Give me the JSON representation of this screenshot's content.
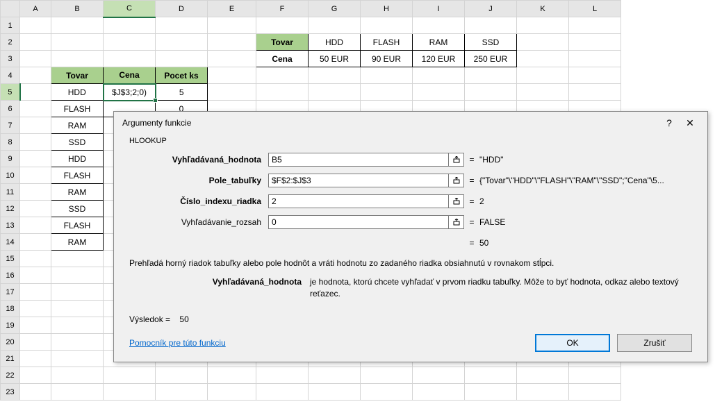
{
  "columns": [
    "A",
    "B",
    "C",
    "D",
    "E",
    "F",
    "G",
    "H",
    "I",
    "J",
    "K",
    "L"
  ],
  "row_count": 23,
  "active_col": "C",
  "active_row": 5,
  "cells": {
    "F2": {
      "text": "Tovar",
      "cls": "green-hdr"
    },
    "G2": {
      "text": "HDD",
      "cls": "bord"
    },
    "H2": {
      "text": "FLASH",
      "cls": "bord"
    },
    "I2": {
      "text": "RAM",
      "cls": "bord"
    },
    "J2": {
      "text": "SSD",
      "cls": "bord"
    },
    "F3": {
      "text": "Cena",
      "cls": "bord bold"
    },
    "G3": {
      "text": "50 EUR",
      "cls": "bord"
    },
    "H3": {
      "text": "90 EUR",
      "cls": "bord"
    },
    "I3": {
      "text": "120 EUR",
      "cls": "bord"
    },
    "J3": {
      "text": "250 EUR",
      "cls": "bord"
    },
    "B4": {
      "text": "Tovar",
      "cls": "green-hdr"
    },
    "C4": {
      "text": "Cena",
      "cls": "green-hdr"
    },
    "D4": {
      "text": "Pocet ks",
      "cls": "green-hdr"
    },
    "B5": {
      "text": "HDD",
      "cls": "bord"
    },
    "C5": {
      "text": "$J$3;2;0)",
      "cls": "bord"
    },
    "D5": {
      "text": "5",
      "cls": "bord"
    },
    "B6": {
      "text": "FLASH",
      "cls": "bord"
    },
    "C6": {
      "text": "",
      "cls": "bord"
    },
    "D6": {
      "text": "0",
      "cls": "bord"
    },
    "B7": {
      "text": "RAM",
      "cls": "bord"
    },
    "B8": {
      "text": "SSD",
      "cls": "bord"
    },
    "B9": {
      "text": "HDD",
      "cls": "bord"
    },
    "B10": {
      "text": "FLASH",
      "cls": "bord"
    },
    "B11": {
      "text": "RAM",
      "cls": "bord"
    },
    "B12": {
      "text": "SSD",
      "cls": "bord"
    },
    "B13": {
      "text": "FLASH",
      "cls": "bord"
    },
    "B14": {
      "text": "RAM",
      "cls": "bord"
    }
  },
  "dialog": {
    "title": "Argumenty funkcie",
    "help": "?",
    "close": "✕",
    "funcname": "HLOOKUP",
    "args": [
      {
        "label": "Vyhľadávaná_hodnota",
        "value": "B5",
        "evaluated": "\"HDD\"",
        "bold": true
      },
      {
        "label": "Pole_tabuľky",
        "value": "$F$2:$J$3",
        "evaluated": "{\"Tovar\"\\\"HDD\"\\\"FLASH\"\\\"RAM\"\\\"SSD\";\"Cena\"\\5...",
        "bold": true
      },
      {
        "label": "Číslo_indexu_riadka",
        "value": "2",
        "evaluated": "2",
        "bold": true
      },
      {
        "label": "Vyhľadávanie_rozsah",
        "value": "0",
        "evaluated": "FALSE",
        "bold": false
      }
    ],
    "result_eq": "=",
    "result_val": "50",
    "description": "Prehľadá horný riadok tabuľky alebo pole hodnôt a vráti hodnotu zo zadaného riadka obsiahnutú v rovnakom stĺpci.",
    "arg_desc_label": "Vyhľadávaná_hodnota",
    "arg_desc_text": "je hodnota, ktorú chcete vyhľadať v prvom riadku tabuľky. Môže to byť hodnota, odkaz alebo textový reťazec.",
    "final_result_label": "Výsledok =",
    "final_result_value": "50",
    "help_link": "Pomocník pre túto funkciu",
    "ok": "OK",
    "cancel": "Zrušiť"
  }
}
